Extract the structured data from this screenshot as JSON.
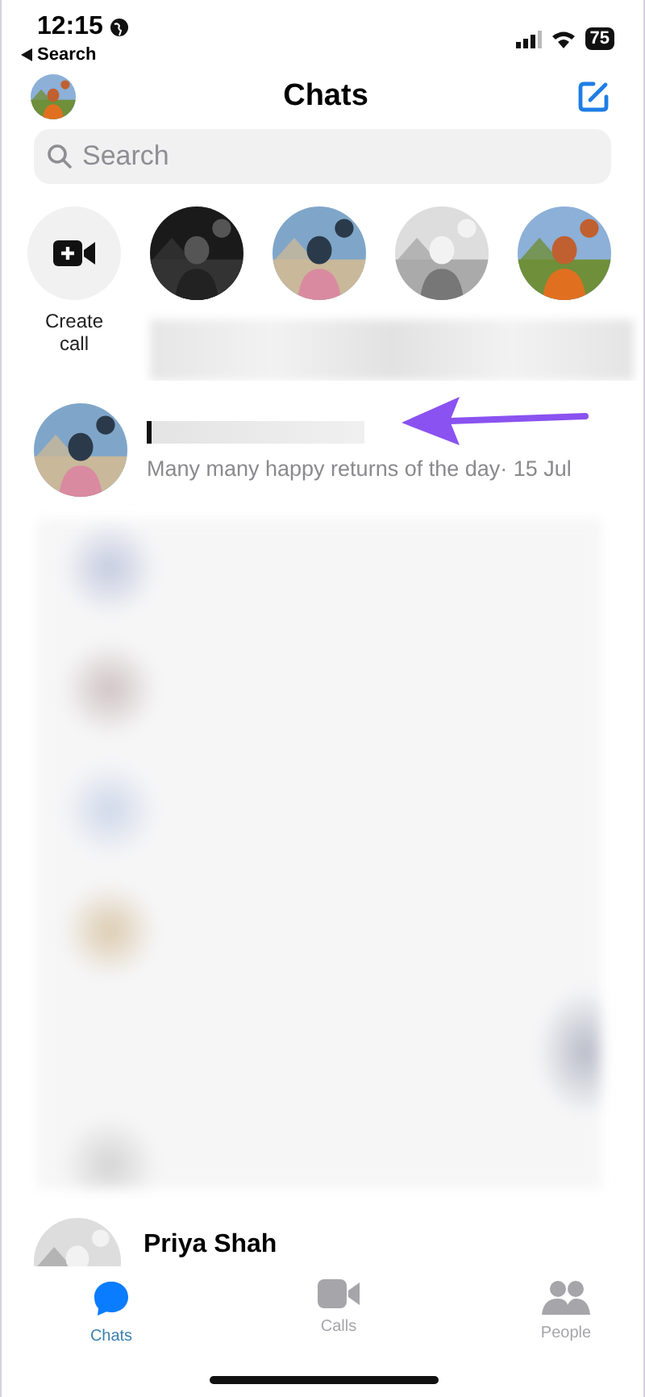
{
  "status_bar": {
    "time": "12:15",
    "back_label": "Search",
    "battery": "75"
  },
  "header": {
    "title": "Chats"
  },
  "search": {
    "placeholder": "Search"
  },
  "create_call": {
    "label": "Create call"
  },
  "highlighted_chat": {
    "message": "Many many happy returns of the day· 15 Jul"
  },
  "last_chat": {
    "name": "Priya Shah"
  },
  "tabs": [
    {
      "label": "Chats",
      "selected": true
    },
    {
      "label": "Calls",
      "selected": false
    },
    {
      "label": "People",
      "selected": false
    }
  ]
}
